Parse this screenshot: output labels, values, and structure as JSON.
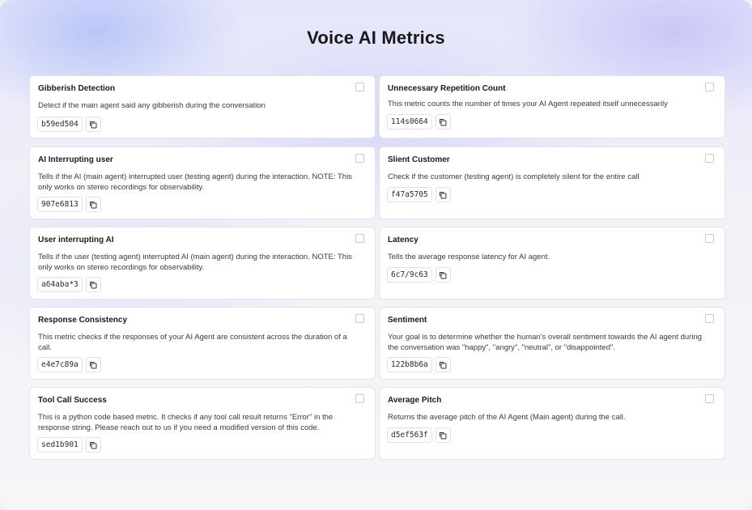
{
  "page": {
    "title": "Voice AI Metrics"
  },
  "metrics": [
    {
      "title": "Gibberish Detection",
      "description": "Detect if the main agent said any gibberish during the conversation",
      "id": "b59ed504",
      "checked": false
    },
    {
      "title": "Unnecessary Repetition Count",
      "description": "This metric counts the number of times your AI Agent repeated itself unnecessarily",
      "id": "114s0664",
      "checked": false
    },
    {
      "title": "AI Interrupting user",
      "description": "Tells if the AI (main agent) interrupted user (testing agent) during the interaction. NOTE: This only works on stereo recordings for observability.",
      "id": "907e6813",
      "checked": false
    },
    {
      "title": "Slient Customer",
      "description": "Check if the customer (testing agent) is completely silent for the entire call",
      "id": "f47a5705",
      "checked": false
    },
    {
      "title": "User interrupting AI",
      "description": "Tells if the user (testing agent) interrupted AI (main agent) during the interaction. NOTE: This only works on stereo recordings for observability.",
      "id": "a64aba*3",
      "checked": false
    },
    {
      "title": "Latency",
      "description": "Tells the average response latency for AI agent.",
      "id": "6c7/9c63",
      "checked": false
    },
    {
      "title": "Response Consistency",
      "description": "This metric checks if the responses of your AI Agent are consistent across the duration of a call.",
      "id": "e4e7c89a",
      "checked": false
    },
    {
      "title": "Sentiment",
      "description": "Your goal is to determine whether the human's overall sentiment towards the AI agent during the conversation was \"happy\", \"angry\", \"neutral\", or \"disappointed\".",
      "id": "122b8b6a",
      "checked": false
    },
    {
      "title": "Tool Call Success",
      "description": "This is a python code based metric. It checks if any tool call result returns \"Error\" in the response string. Please reach out to us if you need a modified version of this code.",
      "id": "sed1b901",
      "checked": false
    },
    {
      "title": "Average Pitch",
      "description": "Returns the average pitch of the AI Agent (Main agent) during the call.",
      "id": "d5ef563f",
      "checked": false
    }
  ],
  "icons": {
    "copy": "copy-icon",
    "checkbox": "checkbox-icon"
  }
}
